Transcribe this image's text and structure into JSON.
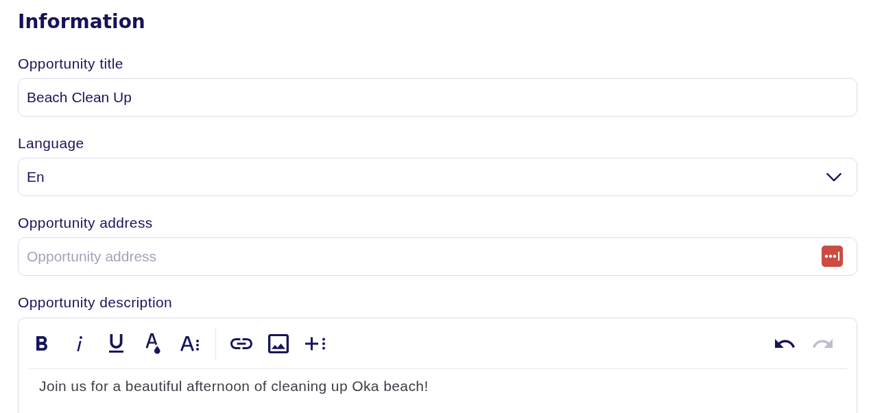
{
  "heading": "Information",
  "fields": [
    {
      "kind": "text",
      "label": "Opportunity title",
      "value": "Beach Clean Up"
    },
    {
      "kind": "select",
      "label": "Language",
      "value": "En"
    },
    {
      "kind": "text",
      "label": "Opportunity address",
      "placeholder": "Opportunity address",
      "password_manager_badge": true
    }
  ],
  "description": {
    "label": "Opportunity description",
    "toolbar": {
      "format": [
        {
          "kind": "bold"
        },
        {
          "kind": "italic"
        },
        {
          "kind": "underline"
        },
        {
          "kind": "text_color"
        },
        {
          "kind": "font_size"
        }
      ],
      "insert": [
        {
          "kind": "link"
        },
        {
          "kind": "image"
        },
        {
          "kind": "insert_more"
        }
      ],
      "history": [
        {
          "kind": "undo",
          "disabled": false
        },
        {
          "kind": "redo",
          "disabled": true
        }
      ]
    },
    "text": "Join us for a beautiful afternoon of cleaning up Oka beach!"
  }
}
